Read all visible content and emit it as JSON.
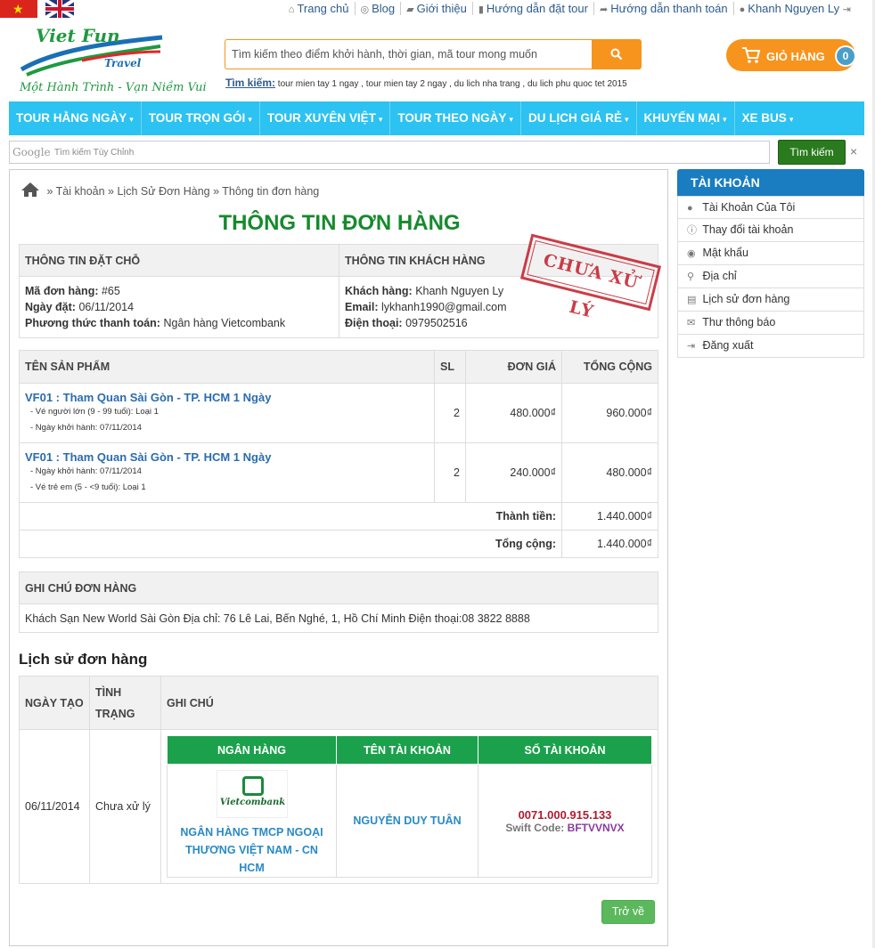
{
  "topbar": {
    "links": [
      {
        "icon": "home-icon",
        "glyph": "⌂",
        "label": "Trang chủ"
      },
      {
        "icon": "globe-icon",
        "glyph": "◎",
        "label": "Blog"
      },
      {
        "icon": "tag-icon",
        "glyph": "▰",
        "label": "Giới thiệu"
      },
      {
        "icon": "bookmark-icon",
        "glyph": "▮",
        "label": "Hướng dẫn đặt tour"
      },
      {
        "icon": "share-icon",
        "glyph": "➦",
        "label": "Hướng dẫn thanh toán"
      },
      {
        "icon": "user-icon",
        "glyph": "●",
        "label": "Khanh Nguyen Ly"
      }
    ]
  },
  "logo": {
    "line1": "Viet Fun",
    "line2": "Travel",
    "slogan": "Một Hành Trình - Vạn Niềm Vui"
  },
  "search": {
    "placeholder": "Tìm kiếm theo điểm khởi hành, thời gian, mã tour mong muốn",
    "hint_label": "Tìm kiếm:",
    "hint_text": "tour mien tay 1 ngay , tour mien tay 2 ngay , du lich nha trang , du lich phu quoc tet 2015"
  },
  "cart": {
    "label": "GIỎ HÀNG",
    "count": "0"
  },
  "nav": {
    "items": [
      "TOUR HẰNG NGÀY",
      "TOUR TRỌN GÓI",
      "TOUR XUYÊN VIỆT",
      "TOUR THEO NGÀY",
      "DU LỊCH GIÁ RẺ",
      "KHUYẾN MẠI",
      "XE BUS"
    ]
  },
  "gsearch": {
    "logo": "Google",
    "placeholder": "Tìm kiếm Tùy Chỉnh",
    "button": "Tìm kiếm",
    "close": "×"
  },
  "breadcrumb": {
    "items": [
      "Tài khoản",
      "Lịch Sử Đơn Hàng",
      "Thông tin đơn hàng"
    ]
  },
  "page_title": "THÔNG TIN ĐƠN HÀNG",
  "stamp": "CHƯA XỬ LÝ",
  "booking": {
    "header": "THÔNG TIN ĐẶT CHỖ",
    "order_label": "Mã đơn hàng:",
    "order_value": "#65",
    "date_label": "Ngày đặt:",
    "date_value": "06/11/2014",
    "pay_label": "Phương thức thanh toán:",
    "pay_value": "Ngân hàng Vietcombank"
  },
  "customer": {
    "header": "THÔNG TIN KHÁCH HÀNG",
    "name_label": "Khách hàng:",
    "name_value": "Khanh Nguyen Ly",
    "email_label": "Email:",
    "email_value": "lykhanh1990@gmail.com",
    "phone_label": "Điện thoại:",
    "phone_value": "0979502516"
  },
  "products": {
    "headers": {
      "name": "TÊN SẢN PHẨM",
      "qty": "SL",
      "price": "ĐƠN GIÁ",
      "total": "TỔNG CỘNG"
    },
    "rows": [
      {
        "name": "VF01 : Tham Quan Sài Gòn - TP. HCM 1 Ngày",
        "sub1": "- Vé người lớn (9 - 99 tuổi): Loại 1",
        "sub2": "- Ngày khởi hành: 07/11/2014",
        "qty": "2",
        "price": "480.000₫",
        "total": "960.000₫"
      },
      {
        "name": "VF01 : Tham Quan Sài Gòn - TP. HCM 1 Ngày",
        "sub1": "- Ngày khởi hành: 07/11/2014",
        "sub2": "- Vé trẻ em (5 - <9 tuổi): Loại 1",
        "qty": "2",
        "price": "240.000₫",
        "total": "480.000₫"
      }
    ],
    "subtotal_label": "Thành tiền:",
    "subtotal_value": "1.440.000₫",
    "grand_label": "Tổng cộng:",
    "grand_value": "1.440.000₫"
  },
  "note": {
    "header": "GHI CHÚ ĐƠN HÀNG",
    "text": "Khách Sạn New World Sài Gòn Địa chỉ: 76 Lê Lai, Bến Nghé, 1, Hồ Chí Minh Điện thoại:08 3822 8888"
  },
  "history": {
    "title": "Lịch sử đơn hàng",
    "headers": {
      "date": "NGÀY TẠO",
      "status_l1": "TÌNH",
      "status_l2": "TRẠNG",
      "note": "GHI CHÚ"
    },
    "row": {
      "date": "06/11/2014",
      "status": "Chưa xử lý"
    },
    "bank": {
      "headers": {
        "bank": "NGÂN HÀNG",
        "account_name": "TÊN TÀI KHOẢN",
        "account_no": "SỐ TÀI KHOẢN"
      },
      "logo_text": "Vietcombank",
      "bank_name_l1": "NGÂN HÀNG TMCP NGOẠI",
      "bank_name_l2": "THƯƠNG VIỆT NAM - CN HCM",
      "account_name": "NGUYỄN DUY TUÂN",
      "account_no": "0071.000.915.133",
      "swift_label": "Swift Code:",
      "swift_value": "BFTVVNVX"
    }
  },
  "back_button": "Trở về",
  "sidebar": {
    "title": "TÀI KHOẢN",
    "items": [
      {
        "icon": "user-icon",
        "glyph": "●",
        "label": "Tài Khoản Của Tôi"
      },
      {
        "icon": "info-icon",
        "glyph": "ⓘ",
        "label": "Thay đổi tài khoản"
      },
      {
        "icon": "eye-icon",
        "glyph": "◉",
        "label": "Mật khẩu"
      },
      {
        "icon": "pin-icon",
        "glyph": "⚲",
        "label": "Địa chỉ"
      },
      {
        "icon": "cart-icon",
        "glyph": "▤",
        "label": "Lịch sử đơn hàng"
      },
      {
        "icon": "mail-icon",
        "glyph": "✉",
        "label": "Thư thông báo"
      },
      {
        "icon": "logout-icon",
        "glyph": "⇥",
        "label": "Đăng xuất"
      }
    ]
  },
  "colors": {
    "accent_orange": "#f7941d",
    "nav_blue": "#2cc2f1",
    "title_green": "#168a2d",
    "bank_green": "#1ba14b",
    "stamp_red": "#c4232f",
    "link_blue": "#2a6cb0"
  }
}
